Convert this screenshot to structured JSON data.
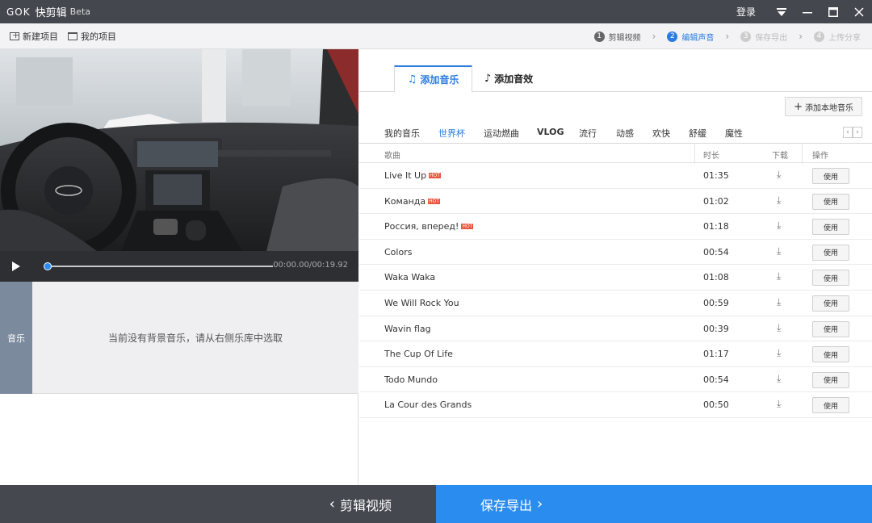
{
  "titlebar": {
    "logo": "GOK",
    "app_name": "快剪辑",
    "beta": "Beta",
    "login": "登录"
  },
  "toolbar": {
    "new_project": "新建项目",
    "my_projects": "我的项目",
    "steps": [
      {
        "num": "1",
        "label": "剪辑视频"
      },
      {
        "num": "2",
        "label": "编辑声音"
      },
      {
        "num": "3",
        "label": "保存导出"
      },
      {
        "num": "4",
        "label": "上传分享"
      }
    ]
  },
  "player": {
    "time": "00:00.00/00:19.92",
    "progress": 0
  },
  "track": {
    "label": "音乐",
    "empty_text": "当前没有背景音乐，请从右侧乐库中选取"
  },
  "tabs": {
    "add_music": "添加音乐",
    "add_effect": "添加音效"
  },
  "add_local": "添加本地音乐",
  "categories": [
    "我的音乐",
    "世界杯",
    "运动燃曲",
    "VLOG",
    "流行",
    "动感",
    "欢快",
    "舒缓",
    "魔性"
  ],
  "table": {
    "headers": {
      "song": "歌曲",
      "duration": "时长",
      "download": "下载",
      "action": "操作"
    },
    "use_label": "使用",
    "hot_label": "HOT",
    "rows": [
      {
        "title": "Live It Up",
        "duration": "01:35",
        "hot": true
      },
      {
        "title": "Команда",
        "duration": "01:02",
        "hot": true
      },
      {
        "title": "Россия, вперед!",
        "duration": "01:18",
        "hot": true
      },
      {
        "title": "Colors",
        "duration": "00:54",
        "hot": false
      },
      {
        "title": "Waka Waka",
        "duration": "01:08",
        "hot": false
      },
      {
        "title": "We Will Rock You",
        "duration": "00:59",
        "hot": false
      },
      {
        "title": "Wavin flag",
        "duration": "00:39",
        "hot": false
      },
      {
        "title": "The Cup Of Life",
        "duration": "01:17",
        "hot": false
      },
      {
        "title": "Todo Mundo",
        "duration": "00:54",
        "hot": false
      },
      {
        "title": "La Cour des Grands",
        "duration": "00:50",
        "hot": false
      }
    ]
  },
  "bottom": {
    "back": "剪辑视频",
    "save": "保存导出"
  },
  "colors": {
    "accent": "#2b7be0",
    "save_button": "#2b8cf0",
    "titlebar": "#44474e"
  }
}
